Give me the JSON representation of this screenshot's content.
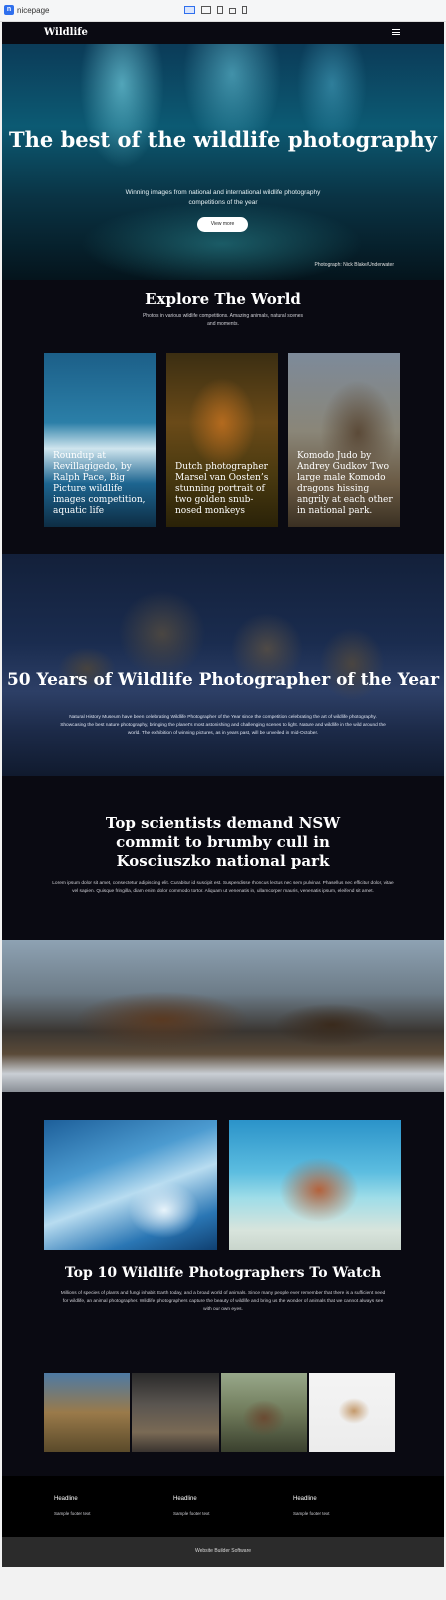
{
  "app": {
    "name": "nicepage",
    "logo_letter": "n"
  },
  "header": {
    "logo": "Wildlife"
  },
  "hero": {
    "title": "The best of the wildlife photography",
    "subtitle": "Winning images from national and international wildlife photography competitions of the year",
    "button": "View more",
    "credit": "Photograph: Nick Blake/Underwater"
  },
  "explore": {
    "title": "Explore The World",
    "description": "Photos in various wildlife competitions. Amazing animals, natural scenes and moments.",
    "cards": [
      {
        "caption": "Roundup at Revillagigedo, by Ralph Pace, Big Picture wildlife images competition, aquatic life"
      },
      {
        "caption": "Dutch photographer Marsel van Oosten’s stunning portrait of two golden snub-nosed monkeys"
      },
      {
        "caption": "Komodo Judo by Andrey Gudkov Two large male Komodo dragons hissing angrily at each other in national park."
      }
    ]
  },
  "elephants": {
    "title": "50 Years of Wildlife Photographer of the Year",
    "text": "Natural History Museum have been celebrating Wildlife Photographer of the Year since the competition celebrating the art of wildlife photography. Showcasing the best nature photography, bringing the planet's most astonishing and challenging scenes to light. Nature and wildlife in the wild around the world. The exhibition of winning pictures, as in years past, will be unveiled in mid-October."
  },
  "scientists": {
    "title": "Top scientists demand NSW commit to brumby cull in Kosciuszko national park",
    "text": "Lorem ipsum dolor sit amet, consectetur adipiscing elit. Curabitur id suscipit est. Suspendisse rhoncus lectus nec sem pulvinar. Phasellus nec efficitur dolor, vitae vel sapien. Quisque fringilla, diam enim dolor commodo tortor. Aliquam ut venenatis in, ullamcorper mauris, venenatis ipsum, eleifend sit amet."
  },
  "top10": {
    "title": "Top 10 Wildlife Photographers To Watch",
    "text": "Millions of species of plants and fungi inhabit Earth today, and a broad world of animals. Since many people ever remember that there is a sufficient need for wildlife, an animal photographer. Wildlife photographers capture the beauty of wildlife and bring us the wonder of animals that we cannot always see with our own eyes."
  },
  "footer": {
    "columns": [
      {
        "heading": "Headline",
        "link": "Sample footer text"
      },
      {
        "heading": "Headline",
        "link": "Sample footer text"
      },
      {
        "heading": "Headline",
        "link": "Sample footer text"
      }
    ],
    "copyright": "Website Builder Software"
  }
}
